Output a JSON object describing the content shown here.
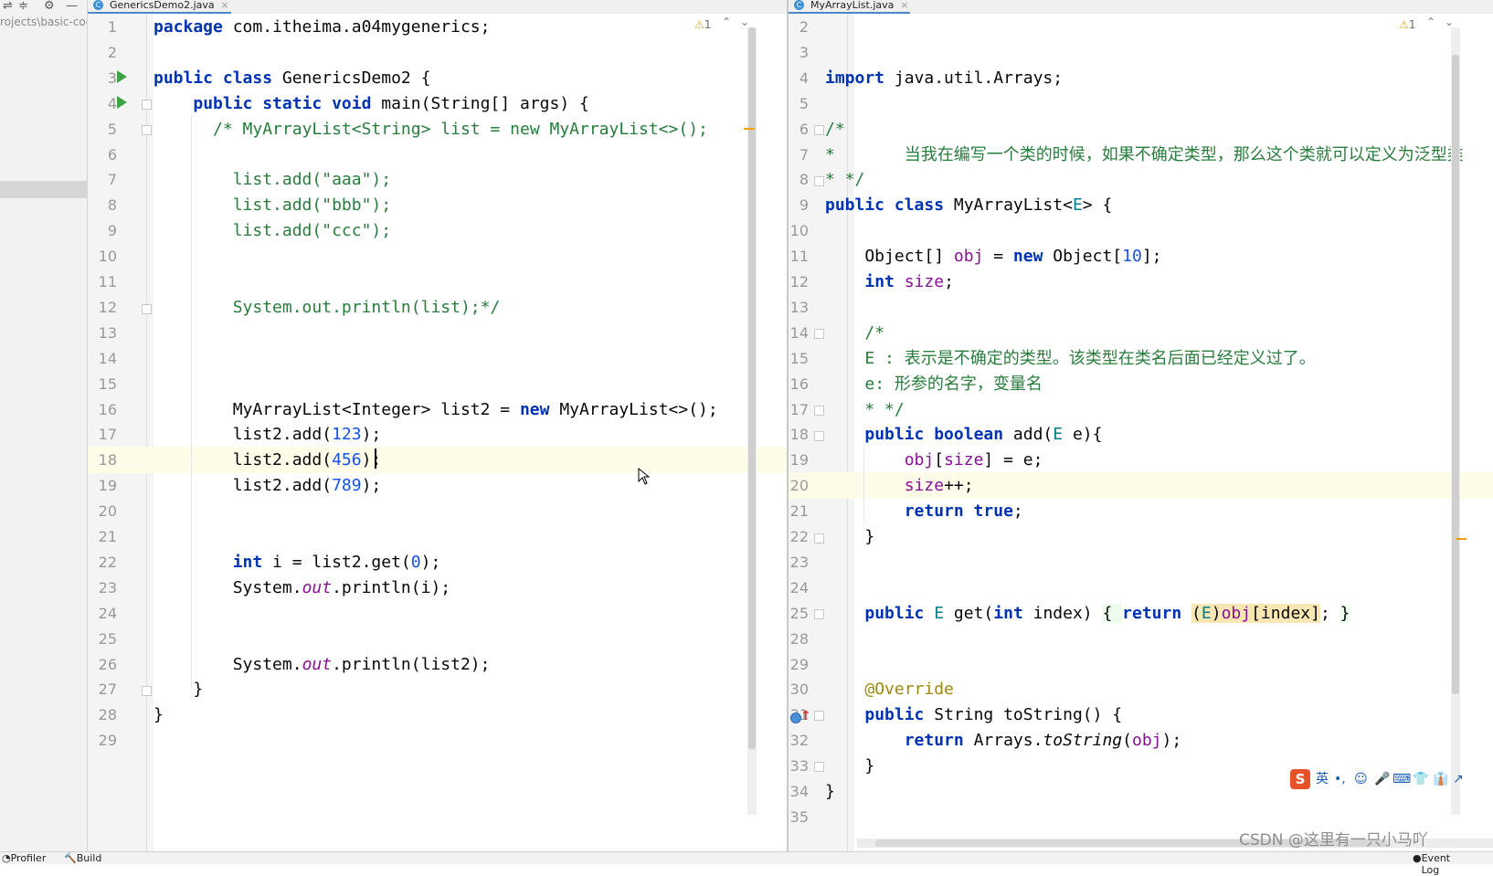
{
  "project": {
    "path_text": "rojects\\basic-cod"
  },
  "left_editor": {
    "tab_label": "GenericsDemo2.java",
    "tab_close": "×",
    "warning_count": "1",
    "lines": [
      {
        "n": "1",
        "html": "<span class='t-k'>package</span> com.itheima.a04mygenerics;"
      },
      {
        "n": "2",
        "html": ""
      },
      {
        "n": "3",
        "html": "<span class='t-k'>public class</span> GenericsDemo2 {"
      },
      {
        "n": "4",
        "html": "    <span class='t-k'>public static void</span> main(String[] args) {"
      },
      {
        "n": "5",
        "html": "      <span class='t-cg'>/* MyArrayList&lt;String&gt; list = new MyArrayList&lt;&gt;();</span>"
      },
      {
        "n": "6",
        "html": ""
      },
      {
        "n": "7",
        "html": "        <span class='t-cg'>list.add(\"aaa\");</span>"
      },
      {
        "n": "8",
        "html": "        <span class='t-cg'>list.add(\"bbb\");</span>"
      },
      {
        "n": "9",
        "html": "        <span class='t-cg'>list.add(\"ccc\");</span>"
      },
      {
        "n": "10",
        "html": ""
      },
      {
        "n": "11",
        "html": ""
      },
      {
        "n": "12",
        "html": "        <span class='t-cg'>System.out.println(list);*/</span>"
      },
      {
        "n": "13",
        "html": ""
      },
      {
        "n": "14",
        "html": ""
      },
      {
        "n": "15",
        "html": ""
      },
      {
        "n": "16",
        "html": "        MyArrayList&lt;Integer&gt; list2 = <span class='t-k'>new</span> MyArrayList&lt;&gt;();"
      },
      {
        "n": "17",
        "html": "        list2.add(<span class='t-n'>123</span>);"
      },
      {
        "n": "18",
        "html": "        list2.add(<span class='t-n'>456</span>);"
      },
      {
        "n": "19",
        "html": "        list2.add(<span class='t-n'>789</span>);"
      },
      {
        "n": "20",
        "html": ""
      },
      {
        "n": "21",
        "html": ""
      },
      {
        "n": "22",
        "html": "        <span class='t-k'>int</span> i = list2.get(<span class='t-n'>0</span>);"
      },
      {
        "n": "23",
        "html": "        System.<span class='t-st'>out</span>.println(i);"
      },
      {
        "n": "24",
        "html": ""
      },
      {
        "n": "25",
        "html": ""
      },
      {
        "n": "26",
        "html": "        System.<span class='t-st'>out</span>.println(list2);"
      },
      {
        "n": "27",
        "html": "    }"
      },
      {
        "n": "28",
        "html": "}"
      },
      {
        "n": "29",
        "html": ""
      }
    ]
  },
  "right_editor": {
    "tab_label": "MyArrayList.java",
    "tab_close": "×",
    "warning_count": "1",
    "lines": [
      {
        "n": "2",
        "html": ""
      },
      {
        "n": "3",
        "html": ""
      },
      {
        "n": "4",
        "html": "<span class='t-k'>import</span> java.util.Arrays;"
      },
      {
        "n": "5",
        "html": ""
      },
      {
        "n": "6",
        "html": "<span class='t-cg'>/*</span>"
      },
      {
        "n": "7",
        "html": "<span class='t-cg'>*       当我在编写一个类的时候，如果不确定类型，那么这个类就可以定义为泛型类</span>"
      },
      {
        "n": "8",
        "html": "<span class='t-cg'>* */</span>"
      },
      {
        "n": "9",
        "html": "<span class='t-k'>public class</span> MyArrayList&lt;<span class='t-tp'>E</span>&gt; {"
      },
      {
        "n": "10",
        "html": ""
      },
      {
        "n": "11",
        "html": "    Object[] <span class='t-f'>obj</span> = <span class='t-k'>new</span> Object[<span class='t-n'>10</span>];"
      },
      {
        "n": "12",
        "html": "    <span class='t-k'>int</span> <span class='t-f'>size</span>;"
      },
      {
        "n": "13",
        "html": ""
      },
      {
        "n": "14",
        "html": "    <span class='t-cg'>/*</span>"
      },
      {
        "n": "15",
        "html": "    <span class='t-cg'>E : 表示是不确定的类型。该类型在类名后面已经定义过了。</span>"
      },
      {
        "n": "16",
        "html": "    <span class='t-cg'>e: 形参的名字，变量名</span>"
      },
      {
        "n": "17",
        "html": "    <span class='t-cg'>* */</span>"
      },
      {
        "n": "18",
        "html": "    <span class='t-k'>public boolean</span> add(<span class='t-tp'>E</span> e){"
      },
      {
        "n": "19",
        "html": "        <span class='t-f'>obj</span>[<span class='t-f'>size</span>] = e;"
      },
      {
        "n": "20",
        "html": "        <span class='t-f'>size</span>++;"
      },
      {
        "n": "21",
        "html": "        <span class='t-k'>return true</span>;"
      },
      {
        "n": "22",
        "html": "    }"
      },
      {
        "n": "23",
        "html": ""
      },
      {
        "n": "24",
        "html": ""
      },
      {
        "n": "25",
        "html": "    <span class='t-k'>public</span> <span class='t-tp'>E</span> get(<span class='t-k'>int</span> index) <span class='t-fold'>{ </span><span class='t-k'>return</span> <span class='t-hl'>(<span class='t-tp'>E</span>)<span class='t-f'>obj</span>[index]</span>; <span class='t-fold'>}</span>"
      },
      {
        "n": "28",
        "html": ""
      },
      {
        "n": "29",
        "html": ""
      },
      {
        "n": "30",
        "html": "    <span class='t-a'>@Override</span>"
      },
      {
        "n": "31",
        "html": "    <span class='t-k'>public</span> String toString() {"
      },
      {
        "n": "32",
        "html": "        <span class='t-k'>return</span> Arrays.<span class='t-m'>toString</span>(<span class='t-f'>obj</span>);"
      },
      {
        "n": "33",
        "html": "    }"
      },
      {
        "n": "34",
        "html": "}"
      },
      {
        "n": "35",
        "html": ""
      }
    ]
  },
  "ime": {
    "logo": "S",
    "lang": "英",
    "punct": "•,",
    "items": [
      "☺",
      "🎤",
      "⌨",
      "👕",
      "👔",
      "↗"
    ]
  },
  "bottom": {
    "profiler": "Profiler",
    "build": "Build",
    "event_log": "Event Log"
  },
  "watermark": "CSDN @这里有一只小马吖"
}
